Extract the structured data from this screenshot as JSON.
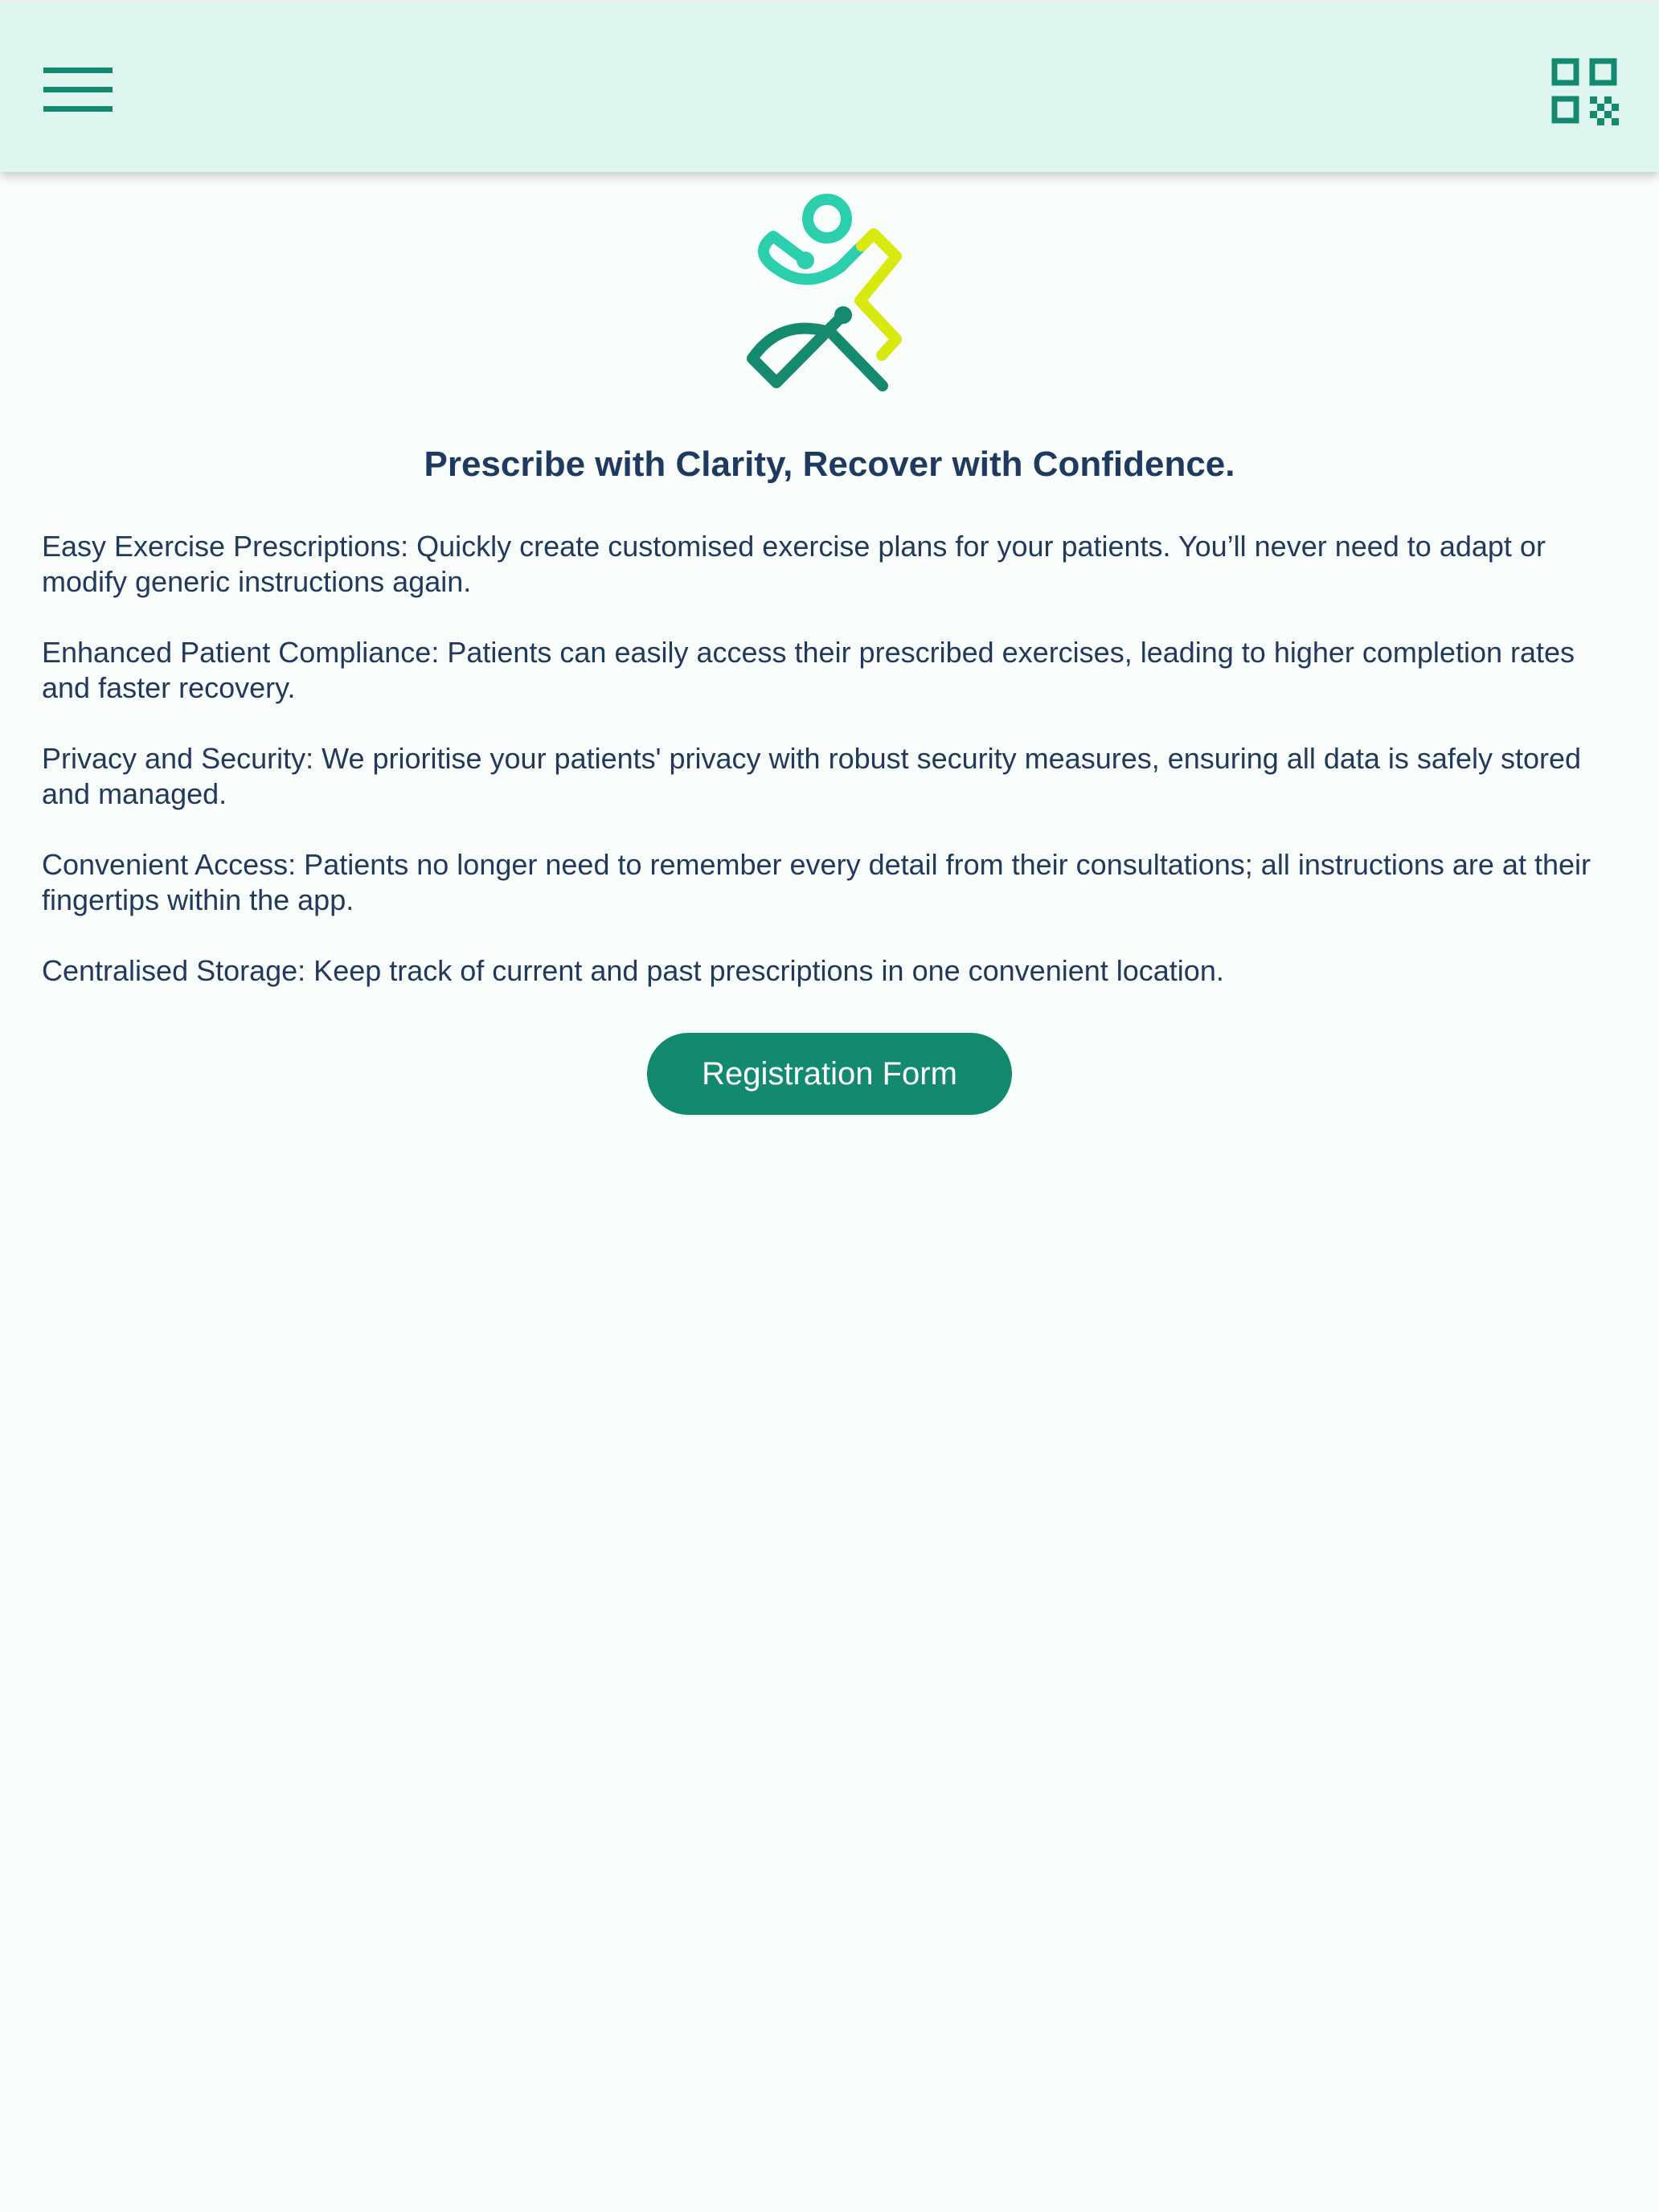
{
  "app_bar": {
    "menu_icon": "hamburger-menu-icon",
    "qr_icon": "qr-code-icon"
  },
  "logo": {
    "icon": "brand-logo-figure",
    "colors": {
      "teal_light": "#2bcfae",
      "teal_dark": "#158a6e",
      "lime": "#d9e80f"
    }
  },
  "headline": "Prescribe with Clarity, Recover with Confidence.",
  "features": [
    "Easy Exercise Prescriptions: Quickly create customised exercise plans for your patients. You’ll never need to adapt or modify generic instructions again.",
    "Enhanced Patient Compliance: Patients can easily access their prescribed exercises, leading to higher completion rates and faster recovery.",
    "Privacy and Security: We prioritise your patients' privacy with robust security measures, ensuring all data is safely stored and managed.",
    "Convenient Access: Patients no longer need to remember every detail from their consultations; all instructions are at their fingertips within the app.",
    "Centralised Storage: Keep track of current and past prescriptions in one convenient location."
  ],
  "cta": {
    "label": "Registration Form"
  },
  "colors": {
    "app_bar_bg": "#def6ef",
    "page_bg": "#f8fcfb",
    "accent": "#138a6f",
    "text": "#22395a"
  }
}
